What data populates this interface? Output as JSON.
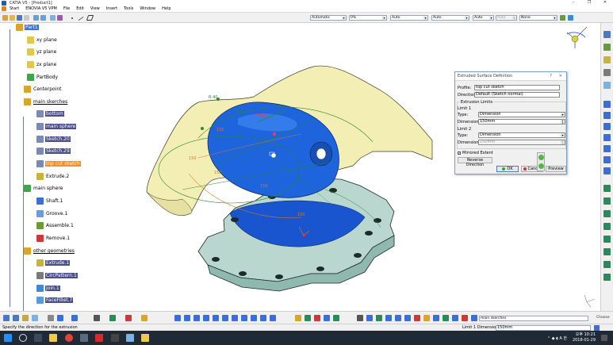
{
  "window": {
    "title": "CATIA V5 - [Product1]",
    "controls": [
      "–",
      "❐",
      "✕"
    ]
  },
  "menubar": {
    "items": [
      "Start",
      "ENOVIA V5 VPM",
      "File",
      "Edit",
      "View",
      "Insert",
      "Tools",
      "Window",
      "Help"
    ]
  },
  "toolbar": {
    "combos": [
      {
        "value": "Automatic",
        "disabled": false
      },
      {
        "value": "0%",
        "disabled": false
      },
      {
        "value": "Auto",
        "disabled": false
      },
      {
        "value": "Auto",
        "disabled": false
      },
      {
        "value": "Auto",
        "disabled": false
      },
      {
        "value": "Auto",
        "disabled": true
      },
      {
        "value": "None",
        "disabled": false
      }
    ]
  },
  "tree": {
    "nodes": [
      {
        "label": "Part1",
        "style": "top",
        "icon": "part-icon"
      },
      {
        "label": "xy plane",
        "style": "plain",
        "icon": "plane-icon"
      },
      {
        "label": "yz plane",
        "style": "plain",
        "icon": "plane-icon"
      },
      {
        "label": "zx plane",
        "style": "plain",
        "icon": "plane-icon"
      },
      {
        "label": "PartBody",
        "style": "plain",
        "icon": "body-icon"
      },
      {
        "label": "Centerpoint",
        "style": "plain",
        "icon": "geoset-icon"
      },
      {
        "label": "main skerches",
        "style": "ul",
        "icon": "geoset-icon"
      },
      {
        "label": "bottom",
        "style": "dark",
        "icon": "sketch-icon"
      },
      {
        "label": "main sphere",
        "style": "dark",
        "icon": "sketch-icon"
      },
      {
        "label": "Sketch.20",
        "style": "dark",
        "icon": "sketch-icon"
      },
      {
        "label": "Sketch.29",
        "style": "dark",
        "icon": "sketch-icon"
      },
      {
        "label": "top cut sketch",
        "style": "sel",
        "icon": "sketch-icon"
      },
      {
        "label": "Extrude.2",
        "style": "plain",
        "icon": "extrude-icon"
      },
      {
        "label": "main sphere",
        "style": "plain",
        "icon": "body-icon"
      },
      {
        "label": "Shaft.1",
        "style": "plain",
        "icon": "shaft-icon"
      },
      {
        "label": "Groove.1",
        "style": "plain",
        "icon": "groove-icon"
      },
      {
        "label": "Assemble.1",
        "style": "plain",
        "icon": "assemble-icon"
      },
      {
        "label": "Remove.1",
        "style": "plain",
        "icon": "remove-icon"
      },
      {
        "label": "other geometries",
        "style": "ul",
        "icon": "geoset-icon"
      },
      {
        "label": "Extrude.1",
        "style": "dark",
        "icon": "extrude-icon"
      },
      {
        "label": "CircPattern.1",
        "style": "dark",
        "icon": "pattern-icon"
      },
      {
        "label": "Join.1",
        "style": "dark",
        "icon": "join-icon"
      },
      {
        "label": "FaceFillet.7",
        "style": "dark",
        "icon": "fillet-icon"
      }
    ]
  },
  "viewport": {
    "labels": {
      "dim_r": "R 40",
      "limit": "Limit 1",
      "profile": "Profile",
      "dim_150a": "150",
      "dim_150b": "150",
      "dim_150c": "150",
      "dim_150d": "150",
      "dim_150e": "150"
    }
  },
  "dialog": {
    "title": "Extruded Surface Definition",
    "help": "?",
    "close": "✕",
    "profile_label": "Profile:",
    "profile_value": "top cut sketch",
    "direction_label": "Direction:",
    "direction_value": "Default (Sketch normal)",
    "limits_group": "Extrusion Limits",
    "limit1_label": "Limit 1",
    "limit1_type_label": "Type:",
    "limit1_type_value": "Dimension",
    "limit1_dim_label": "Dimension:",
    "limit1_dim_value": "150mm",
    "limit2_label": "Limit 2",
    "limit2_type_label": "Type:",
    "limit2_type_value": "Dimension",
    "limit2_dim_label": "Dimension:",
    "limit2_dim_value": "150mm",
    "mirrored_label": "Mirrored Extent",
    "mirrored_checked": true,
    "reverse_label": "Reverse Direction",
    "ok_label": "OK",
    "cancel_label": "Cancel",
    "preview_label": "Preview"
  },
  "bottombar": {
    "combo_value": "main skerches",
    "right_label": "Choose"
  },
  "status": {
    "prompt": "Specify the direction for the extrusion",
    "field_label": "Limit 1 Dimension:",
    "field_value": "150mm"
  },
  "taskbar": {
    "time": "오후 10:21",
    "date": "2018-01-29",
    "tray_lang": "A",
    "tray_ime": "한"
  },
  "colors": {
    "accent": "#3a6ed8",
    "selected": "#ff8c1a",
    "tree_dark": "#4a4f8a",
    "surface": "#f2eeb0",
    "sphere": "#1a5fd6",
    "base": "#b6d3cd"
  }
}
